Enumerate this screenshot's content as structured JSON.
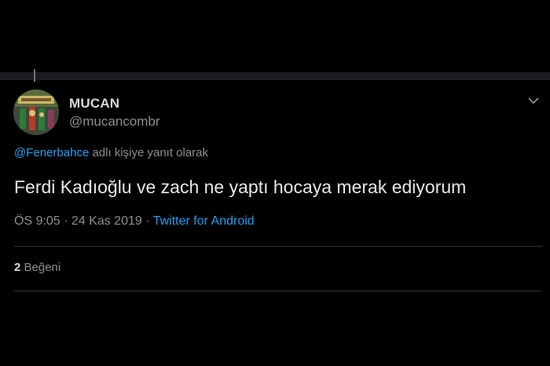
{
  "tweet": {
    "display_name": "MUCAN",
    "handle": "@mucancombr",
    "reply_to_mention": "@Fenerbahce",
    "reply_to_suffix": " adlı kişiye yanıt olarak",
    "text": "Ferdi Kadıoğlu ve zach ne yaptı hocaya merak ediyorum",
    "time": "ÖS 9:05",
    "separator": " · ",
    "date": "24 Kas 2019",
    "source": "Twitter for Android",
    "likes_count": "2",
    "likes_label": " Beğeni"
  },
  "icons": {
    "menu": "chevron-down-icon",
    "avatar": "avatar-image"
  },
  "colors": {
    "background": "#000000",
    "text_primary": "#d9d9d9",
    "text_secondary": "#8a8f94",
    "accent_link": "#1da1f2",
    "divider": "#2f3336"
  }
}
